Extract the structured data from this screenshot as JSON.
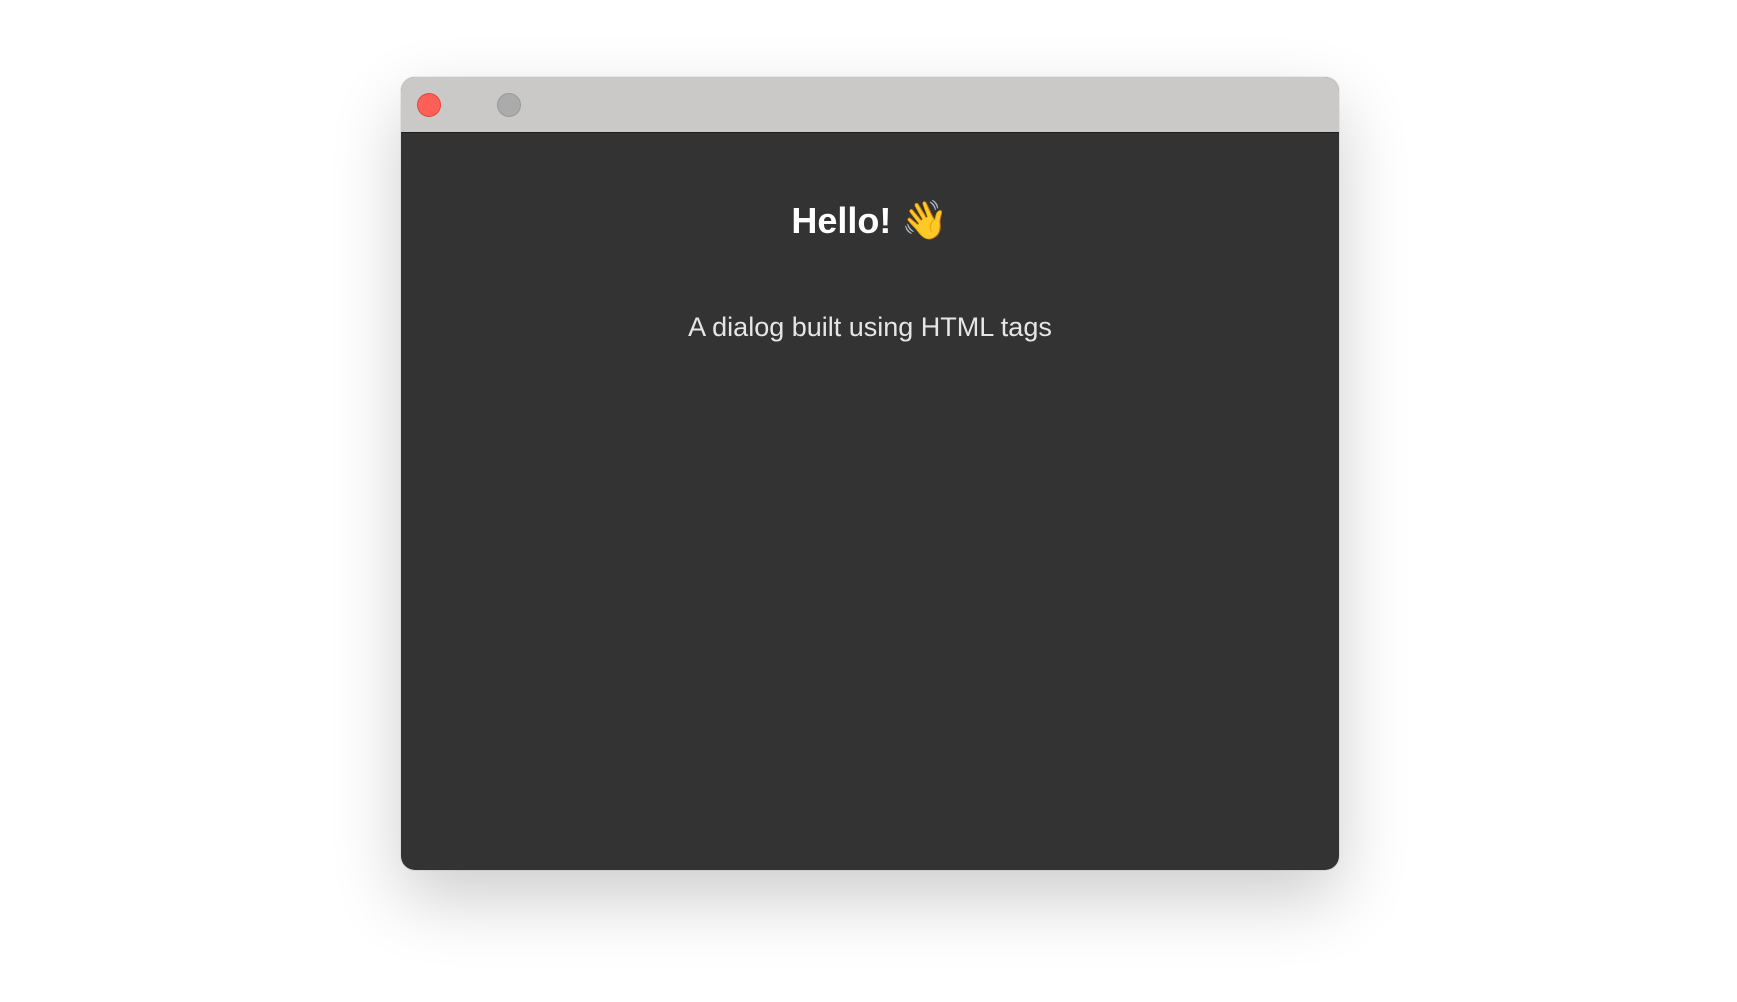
{
  "window": {
    "heading": "Hello!",
    "heading_emoji": "👋",
    "subtitle": "A dialog built using HTML tags"
  },
  "icons": {
    "close": "close-traffic-light",
    "zoom": "zoom-traffic-light",
    "emoji": "waving-hand-emoji"
  },
  "colors": {
    "titlebar": "#cac9c7",
    "window_background": "#333333",
    "close": "#fe5f57",
    "zoom": "#ababab",
    "heading_text": "#ffffff",
    "subtitle_text": "#e6e6e6"
  }
}
